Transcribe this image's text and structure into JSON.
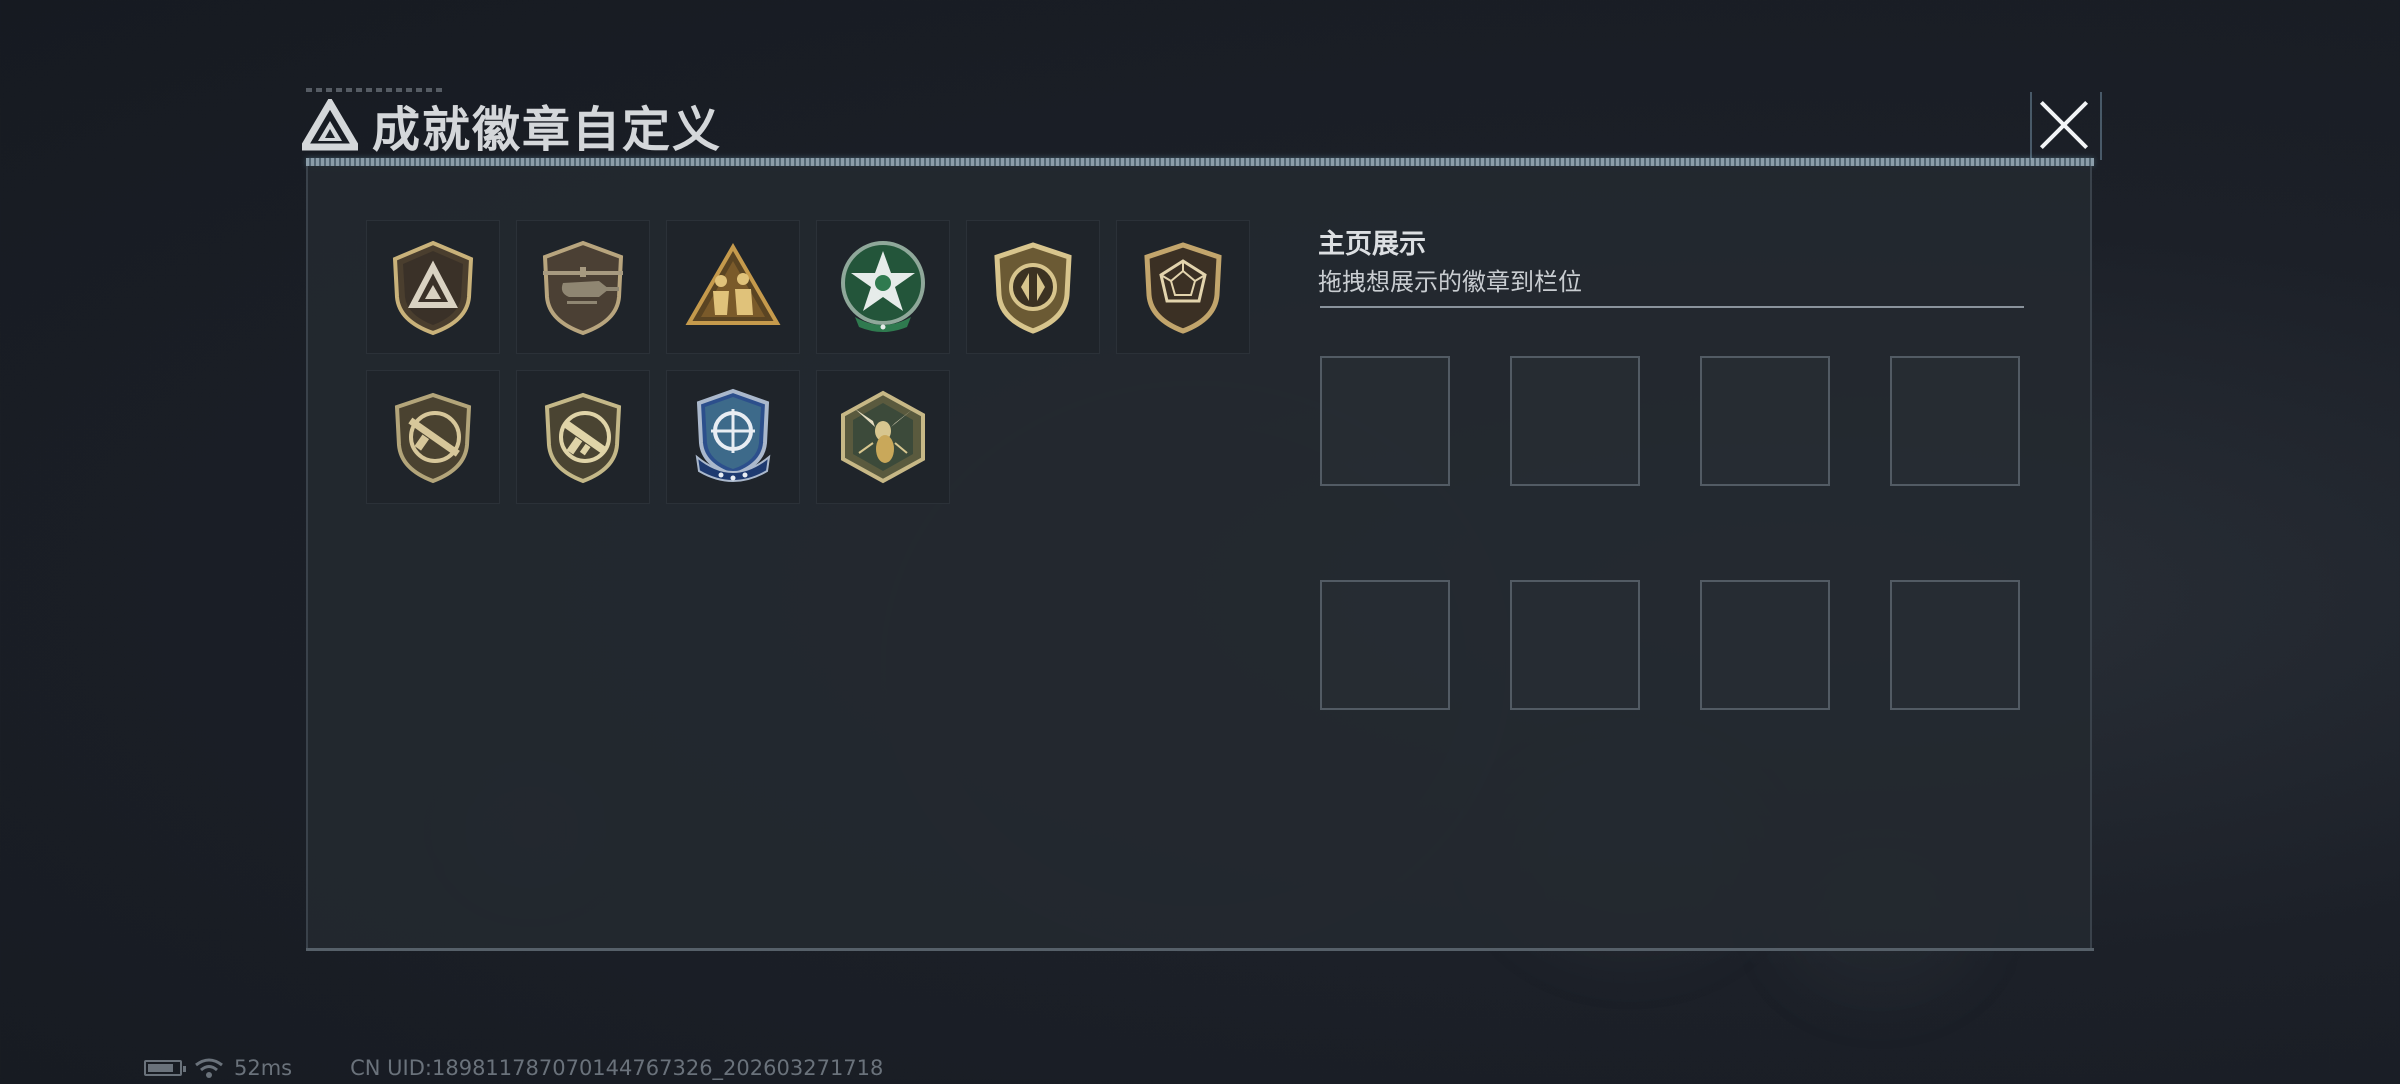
{
  "header": {
    "title": "成就徽章自定义",
    "logo_icon": "triangle-logo-icon",
    "close_icon": "close-icon"
  },
  "badges": [
    {
      "icon": "triangle-shield-badge-icon"
    },
    {
      "icon": "helicopter-shield-badge-icon"
    },
    {
      "icon": "soldiers-triangle-badge-icon"
    },
    {
      "icon": "green-star-badge-icon"
    },
    {
      "icon": "gold-shield-badge-icon"
    },
    {
      "icon": "dodecahedron-shield-badge-icon"
    },
    {
      "icon": "rifle-shield-badge-icon"
    },
    {
      "icon": "smg-shield-badge-icon"
    },
    {
      "icon": "blue-crosshair-badge-icon"
    },
    {
      "icon": "wasp-hexagon-badge-icon"
    }
  ],
  "showcase": {
    "title": "主页展示",
    "subtitle": "拖拽想展示的徽章到栏位",
    "slot_count": 8
  },
  "status_bar": {
    "battery_level": 0.85,
    "ping": "52ms",
    "uid": "CN UID:18981178707014476732​6_202603271718"
  },
  "colors": {
    "accent": "#9fb3c0",
    "badge_gold": "#c9b27a",
    "badge_green": "#2f7a4f",
    "badge_blue": "#2c4f8c"
  }
}
